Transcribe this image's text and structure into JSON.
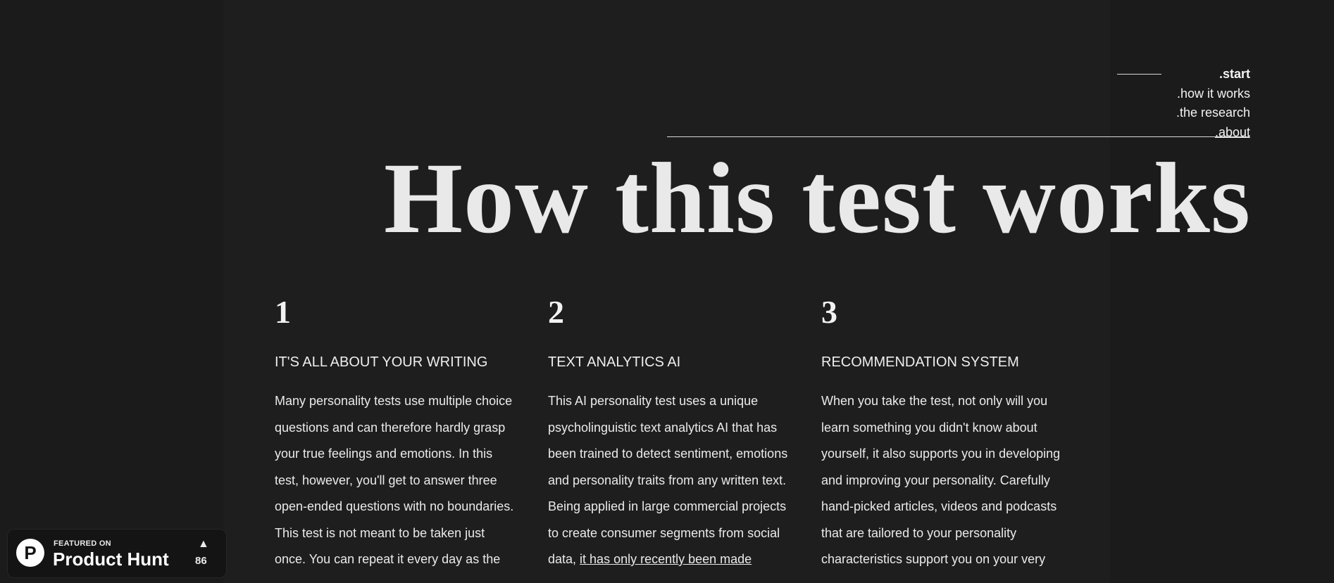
{
  "nav": {
    "items": [
      ".start",
      ".how it works",
      ".the research",
      ".about"
    ]
  },
  "hero": {
    "title": "How this test works"
  },
  "columns": [
    {
      "number": "1",
      "heading": "IT'S ALL ABOUT YOUR WRITING",
      "body": "Many personality tests use multiple choice questions and can therefore hardly grasp your true feelings and emotions. In this test, however, you'll get to answer three open-ended questions with no boundaries. This test is not meant to be taken just once. You can repeat it every day as the"
    },
    {
      "number": "2",
      "heading": "TEXT ANALYTICS AI",
      "body": "This AI personality test uses a unique psycholinguistic text analytics AI that has been trained to detect sentiment, emotions and personality traits from any written text. Being applied in large commercial projects to create consumer segments from social data, ",
      "link": "it has only recently been made"
    },
    {
      "number": "3",
      "heading": "RECOMMENDATION SYSTEM",
      "body": "When you take the test, not only will you learn something you didn't know about yourself, it also supports you in developing and improving your personality. Carefully hand-picked articles, videos and podcasts that are tailored to your personality characteristics support you on your very"
    }
  ],
  "product_hunt": {
    "logo_letter": "P",
    "featured": "FEATURED ON",
    "name": "Product Hunt",
    "arrow": "▲",
    "votes": "86"
  }
}
